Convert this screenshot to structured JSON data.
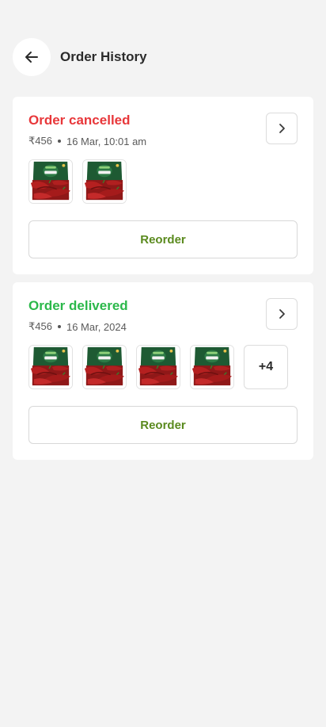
{
  "header": {
    "title": "Order History",
    "back_icon": "arrow-left-icon"
  },
  "orders": [
    {
      "status": "Order cancelled",
      "status_color": "#e8373a",
      "price": "₹456",
      "datetime": "16 Mar, 10:01 am",
      "product_image": "chilli-pack-image",
      "product_brand": "Daily good",
      "product_count": 2,
      "more_label": "",
      "reorder_label": "Reorder"
    },
    {
      "status": "Order delivered",
      "status_color": "#2bb84a",
      "price": "₹456",
      "datetime": "16 Mar, 2024",
      "product_image": "chilli-pack-image",
      "product_brand": "Daily good",
      "product_count": 4,
      "more_label": "+4",
      "reorder_label": "Reorder"
    }
  ],
  "colors": {
    "background": "#f3f3f3",
    "card": "#ffffff",
    "reorder_text": "#5a8a1e",
    "pack_green": "#1e5a33",
    "chilli_red": "#9c1c1c"
  }
}
